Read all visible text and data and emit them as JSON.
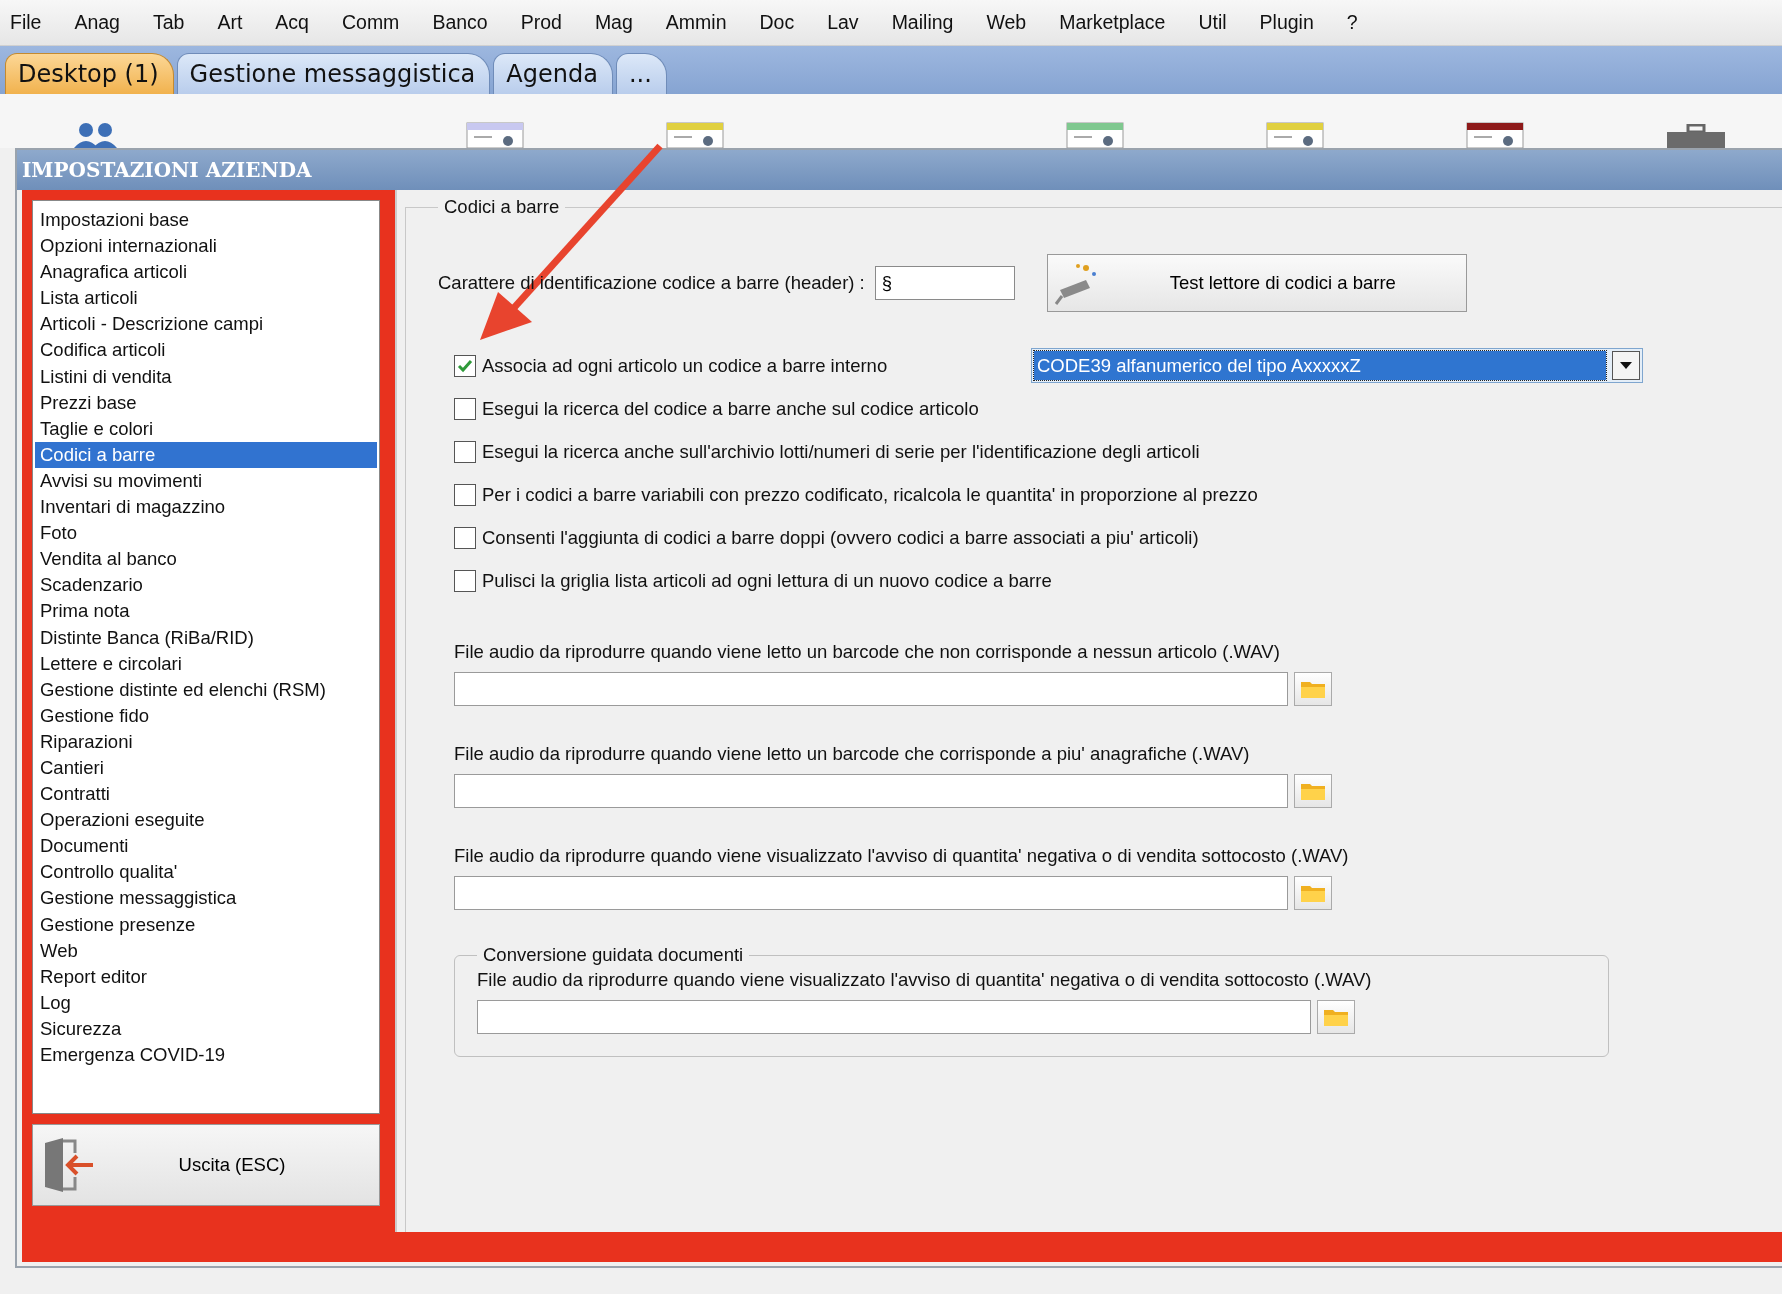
{
  "menu": [
    "File",
    "Anag",
    "Tab",
    "Art",
    "Acq",
    "Comm",
    "Banco",
    "Prod",
    "Mag",
    "Ammin",
    "Doc",
    "Lav",
    "Mailing",
    "Web",
    "Marketplace",
    "Util",
    "Plugin",
    "?"
  ],
  "tabs": [
    {
      "label": "Desktop (1)",
      "selected": true
    },
    {
      "label": "Gestione messaggistica",
      "selected": false
    },
    {
      "label": "Agenda",
      "selected": false
    },
    {
      "label": "...",
      "selected": false
    }
  ],
  "window": {
    "title": "IMPOSTAZIONI AZIENDA"
  },
  "sidebar": {
    "items": [
      {
        "label": "Impostazioni base",
        "selected": false
      },
      {
        "label": "Opzioni internazionali",
        "selected": false
      },
      {
        "label": "Anagrafica articoli",
        "selected": false
      },
      {
        "label": "Lista articoli",
        "selected": false
      },
      {
        "label": "Articoli - Descrizione campi",
        "selected": false
      },
      {
        "label": "Codifica articoli",
        "selected": false
      },
      {
        "label": "Listini di vendita",
        "selected": false
      },
      {
        "label": "Prezzi base",
        "selected": false
      },
      {
        "label": "Taglie e colori",
        "selected": false
      },
      {
        "label": "Codici a barre",
        "selected": true
      },
      {
        "label": "Avvisi su movimenti",
        "selected": false
      },
      {
        "label": "Inventari di magazzino",
        "selected": false
      },
      {
        "label": "Foto",
        "selected": false
      },
      {
        "label": "Vendita al banco",
        "selected": false
      },
      {
        "label": "Scadenzario",
        "selected": false
      },
      {
        "label": "Prima nota",
        "selected": false
      },
      {
        "label": "Distinte Banca (RiBa/RID)",
        "selected": false
      },
      {
        "label": "Lettere e circolari",
        "selected": false
      },
      {
        "label": "Gestione distinte ed elenchi (RSM)",
        "selected": false
      },
      {
        "label": "Gestione fido",
        "selected": false
      },
      {
        "label": "Riparazioni",
        "selected": false
      },
      {
        "label": "Cantieri",
        "selected": false
      },
      {
        "label": "Contratti",
        "selected": false
      },
      {
        "label": "Operazioni eseguite",
        "selected": false
      },
      {
        "label": "Documenti",
        "selected": false
      },
      {
        "label": "Controllo qualita'",
        "selected": false
      },
      {
        "label": "Gestione messaggistica",
        "selected": false
      },
      {
        "label": "Gestione presenze",
        "selected": false
      },
      {
        "label": "Web",
        "selected": false
      },
      {
        "label": "Report editor",
        "selected": false
      },
      {
        "label": "Log",
        "selected": false
      },
      {
        "label": "Sicurezza",
        "selected": false
      },
      {
        "label": "Emergenza COVID-19",
        "selected": false
      }
    ],
    "exit_button": "Uscita (ESC)"
  },
  "barcode_group": {
    "title": "Codici a barre",
    "header_label": "Carattere di identificazione codice a barre (header) :",
    "header_value": "§",
    "test_button": "Test lettore di codici a barre",
    "barcode_type": "CODE39 alfanumerico del tipo AxxxxxZ",
    "checkboxes": [
      {
        "label": "Associa ad ogni articolo un codice a barre interno",
        "checked": true
      },
      {
        "label": "Esegui la ricerca del codice a barre anche sul codice articolo",
        "checked": false
      },
      {
        "label": "Esegui la ricerca anche sull'archivio lotti/numeri di serie per l'identificazione degli articoli",
        "checked": false
      },
      {
        "label": "Per i codici a barre variabili con prezzo codificato, ricalcola le quantita' in proporzione al prezzo",
        "checked": false
      },
      {
        "label": "Consenti l'aggiunta di codici a barre doppi (ovvero codici a barre associati a piu' articoli)",
        "checked": false
      },
      {
        "label": "Pulisci la griglia lista articoli ad ogni lettura di un nuovo codice a barre",
        "checked": false
      }
    ],
    "audio_files": [
      {
        "label": "File audio da riprodurre quando viene letto un barcode che non corrisponde a nessun articolo (.WAV)"
      },
      {
        "label": "File audio da riprodurre quando viene letto un barcode che corrisponde a piu' anagrafiche (.WAV)"
      },
      {
        "label": "File audio da riprodurre quando viene visualizzato l'avviso di quantita' negativa o di vendita sottocosto (.WAV)"
      }
    ]
  },
  "conversion_group": {
    "title": "Conversione guidata documenti",
    "audio_files": [
      {
        "label": "File audio da riprodurre quando viene visualizzato l'avviso di quantita' negativa o di vendita sottocosto (.WAV)"
      }
    ]
  }
}
